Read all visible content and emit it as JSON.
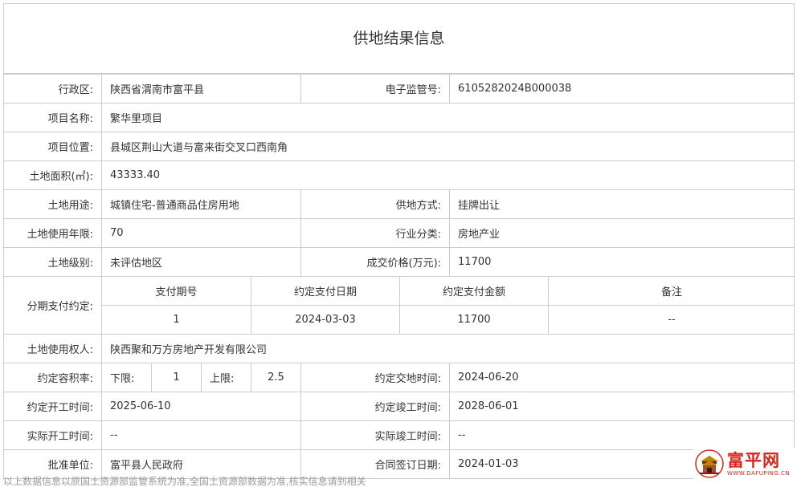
{
  "title": "供地结果信息",
  "labels": {
    "district": "行政区:",
    "supervision_no": "电子监管号:",
    "project_name": "项目名称:",
    "project_location": "项目位置:",
    "land_area": "土地面积(㎡):",
    "land_use": "土地用途:",
    "supply_method": "供地方式:",
    "use_years": "土地使用年限:",
    "industry": "行业分类:",
    "land_level": "土地级别:",
    "deal_price": "成交价格(万元):",
    "installment": "分期支付约定:",
    "land_user": "土地使用权人:",
    "plot_ratio": "约定容积率:",
    "lower": "下限:",
    "upper": "上限:",
    "agreed_delivery": "约定交地时间:",
    "agreed_start": "约定开工时间:",
    "agreed_completion": "约定竣工时间:",
    "actual_start": "实际开工时间:",
    "actual_completion": "实际竣工时间:",
    "approval_unit": "批准单位:",
    "contract_date": "合同签订日期:"
  },
  "values": {
    "district": "陕西省渭南市富平县",
    "supervision_no": "6105282024B000038",
    "project_name": "繁华里项目",
    "project_location": "县城区荆山大道与富来街交叉口西南角",
    "land_area": "43333.40",
    "land_use": "城镇住宅-普通商品住房用地",
    "supply_method": "挂牌出让",
    "use_years": "70",
    "industry": "房地产业",
    "land_level": "未评估地区",
    "deal_price": "11700",
    "land_user": "陕西聚和万方房地产开发有限公司",
    "plot_lower": "1",
    "plot_upper": "2.5",
    "agreed_delivery": "2024-06-20",
    "agreed_start": "2025-06-10",
    "agreed_completion": "2028-06-01",
    "actual_start": "--",
    "actual_completion": "--",
    "approval_unit": "富平县人民政府",
    "contract_date": "2024-01-03"
  },
  "installment_table": {
    "headers": [
      "支付期号",
      "约定支付日期",
      "约定支付金额",
      "备注"
    ],
    "rows": [
      [
        "1",
        "2024-03-03",
        "11700",
        "--"
      ]
    ]
  },
  "bottom_text": "以上数据信息以原国土资源部监管系统为准,全国土资源部数据为准,核实信息请到相关",
  "watermark": {
    "name": "富平网",
    "domain": "WWW.DAFUPING.CN",
    "color": "#d9261c"
  },
  "icons": {
    "watermark": "city-gate-icon"
  }
}
